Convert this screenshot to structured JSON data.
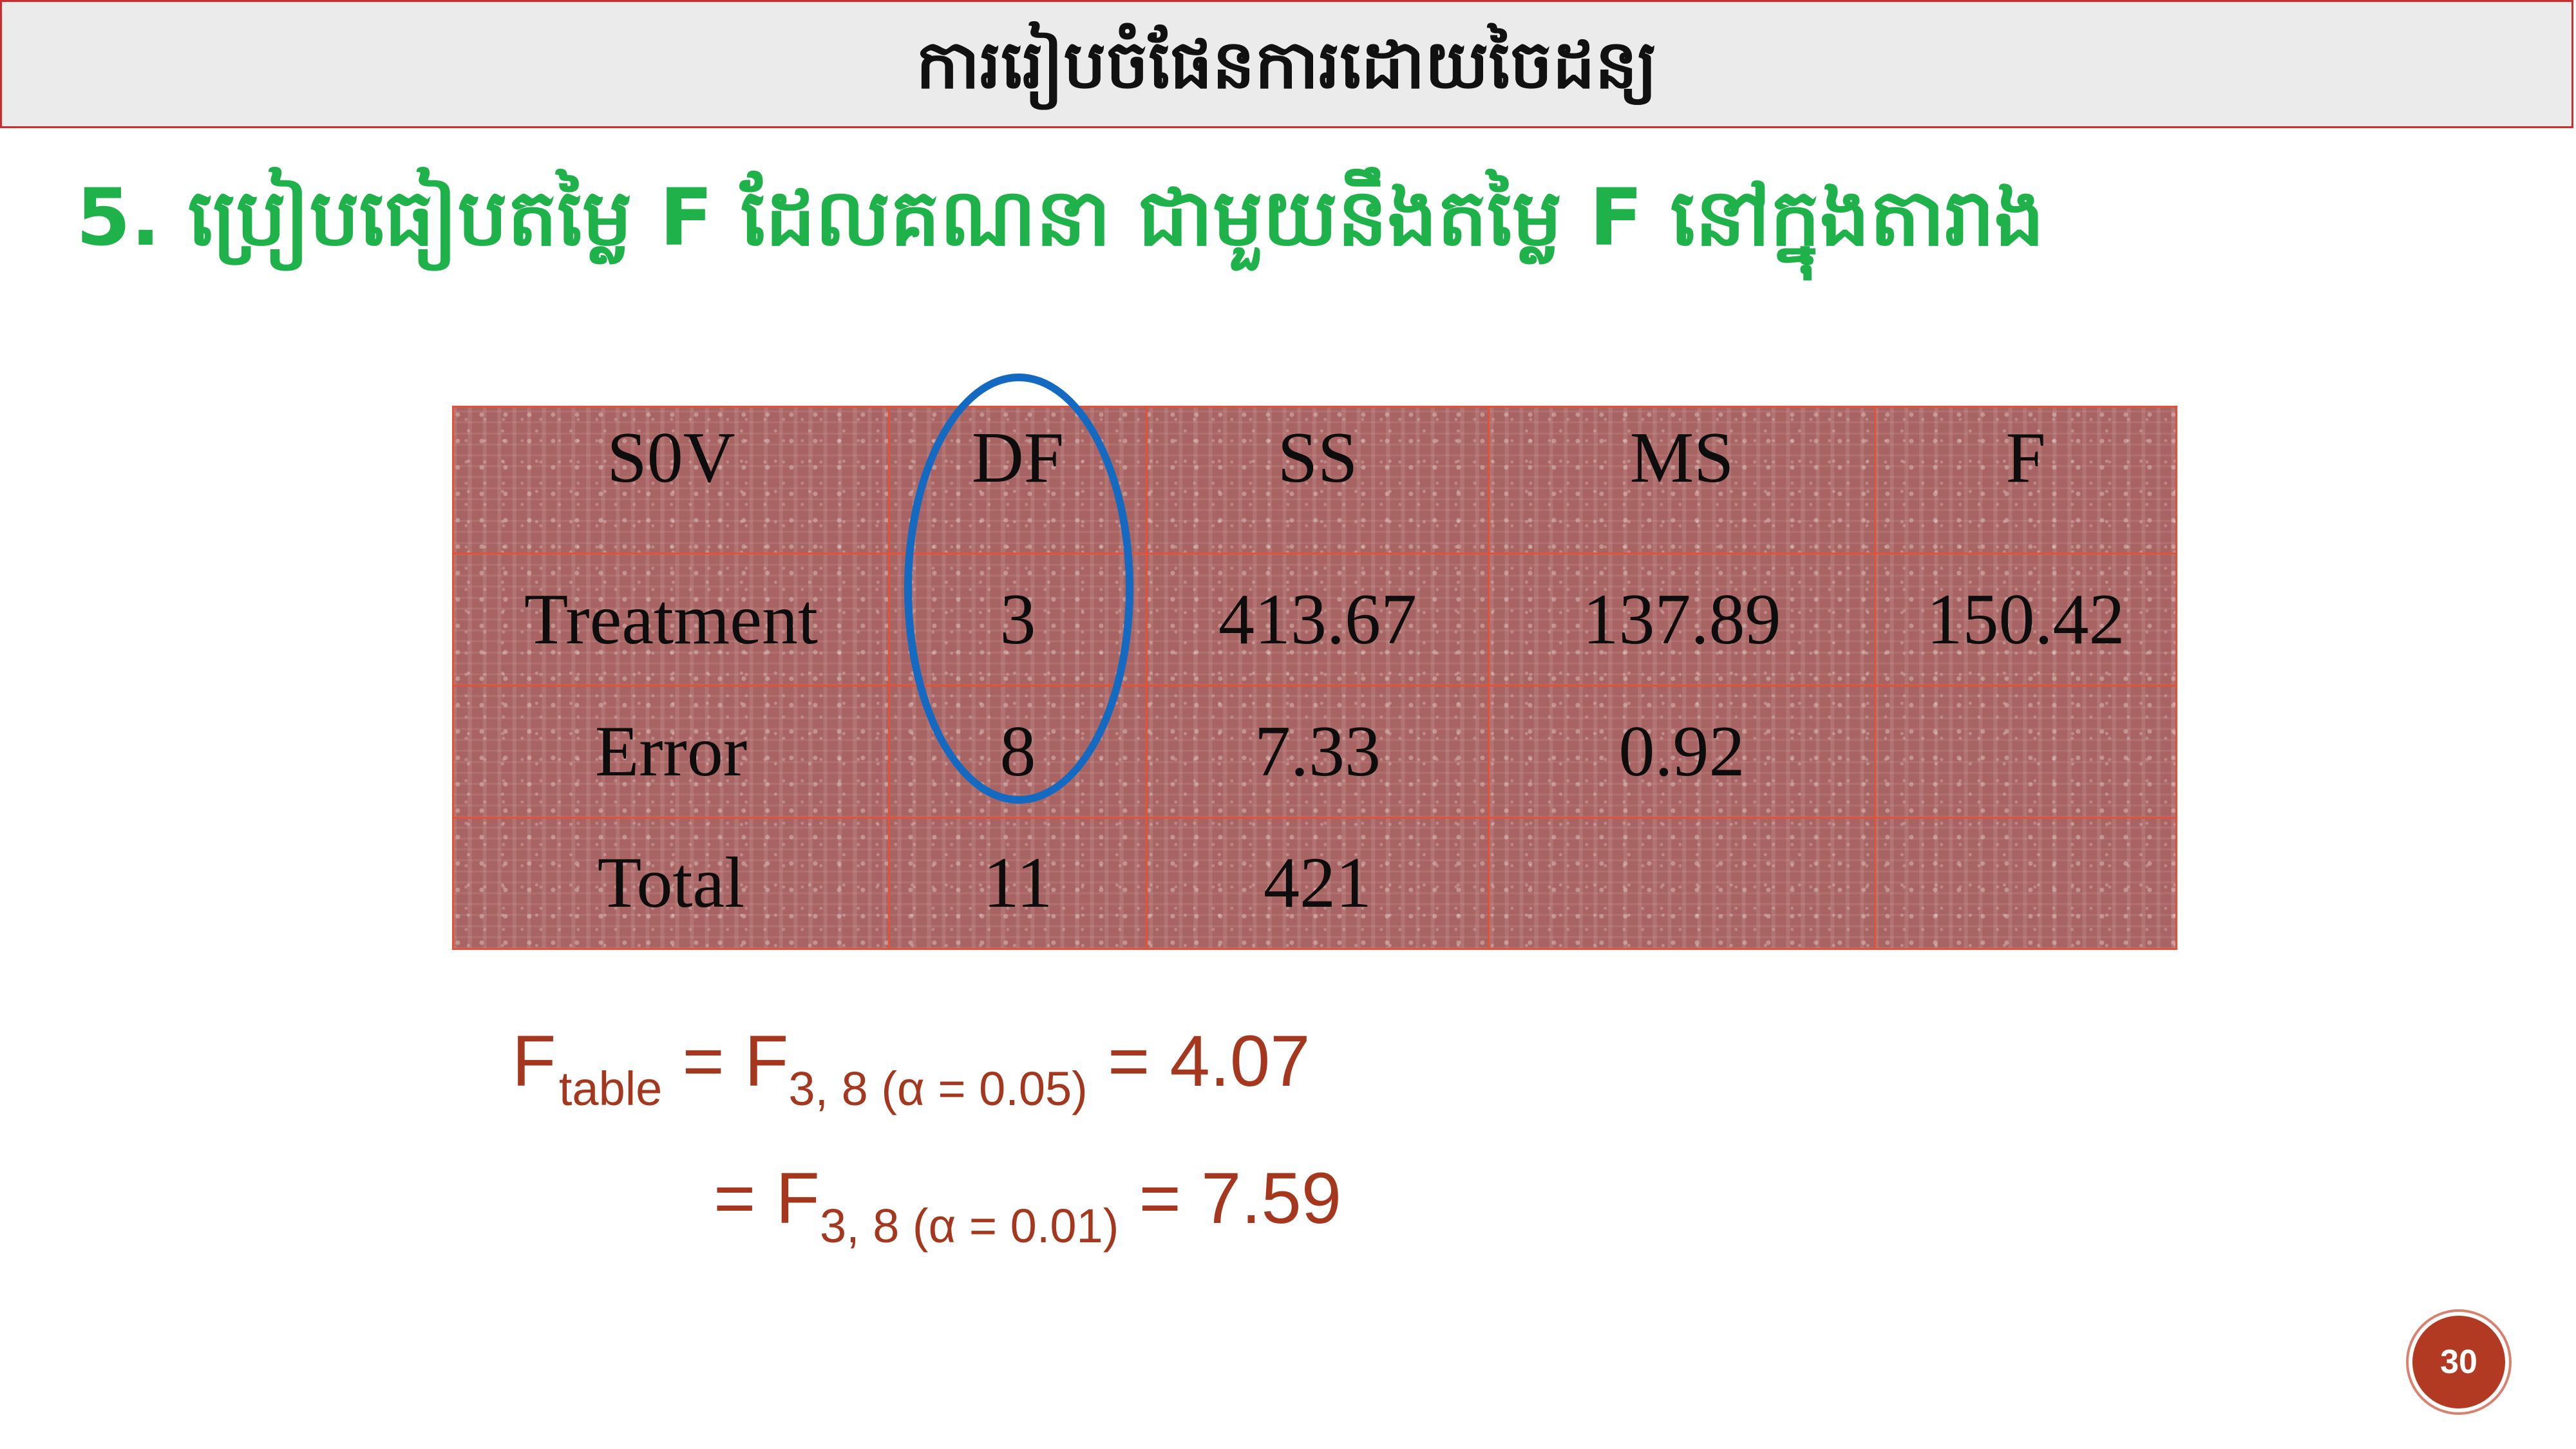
{
  "header": {
    "title": "ការរៀបចំផែនការដោយចៃដន្យ"
  },
  "heading": "5. ប្រៀបធៀបតម្លៃ F ដែលគណនា ជាមួយនឹងតម្លៃ F នៅក្នុងតារាង",
  "anova_table": {
    "headers": [
      "S0V",
      "DF",
      "SS",
      "MS",
      "F"
    ],
    "rows": [
      [
        "Treatment",
        "3",
        "413.67",
        "137.89",
        "150.42"
      ],
      [
        "Error",
        "8",
        "7.33",
        "0.92",
        ""
      ],
      [
        "Total",
        "11",
        "421",
        "",
        ""
      ]
    ]
  },
  "f_table": {
    "line1": {
      "f": "F",
      "table_sub": "table",
      "eq1": " = F",
      "sub": "3, 8 (α = 0.05)",
      "result": " = 4.07"
    },
    "line2": {
      "eq1": "= F",
      "sub": "3, 8 (α = 0.01)",
      "result": " = 7.59"
    }
  },
  "page_number": "30",
  "colors": {
    "title_border": "#cc2e2e",
    "title_bg": "#ebebeb",
    "heading": "#1fb14a",
    "table_bg": "#a86462",
    "table_grid": "#e0533a",
    "highlight_oval": "#1469c0",
    "formula_text": "#a5371e",
    "page_badge": "#b23a23"
  }
}
